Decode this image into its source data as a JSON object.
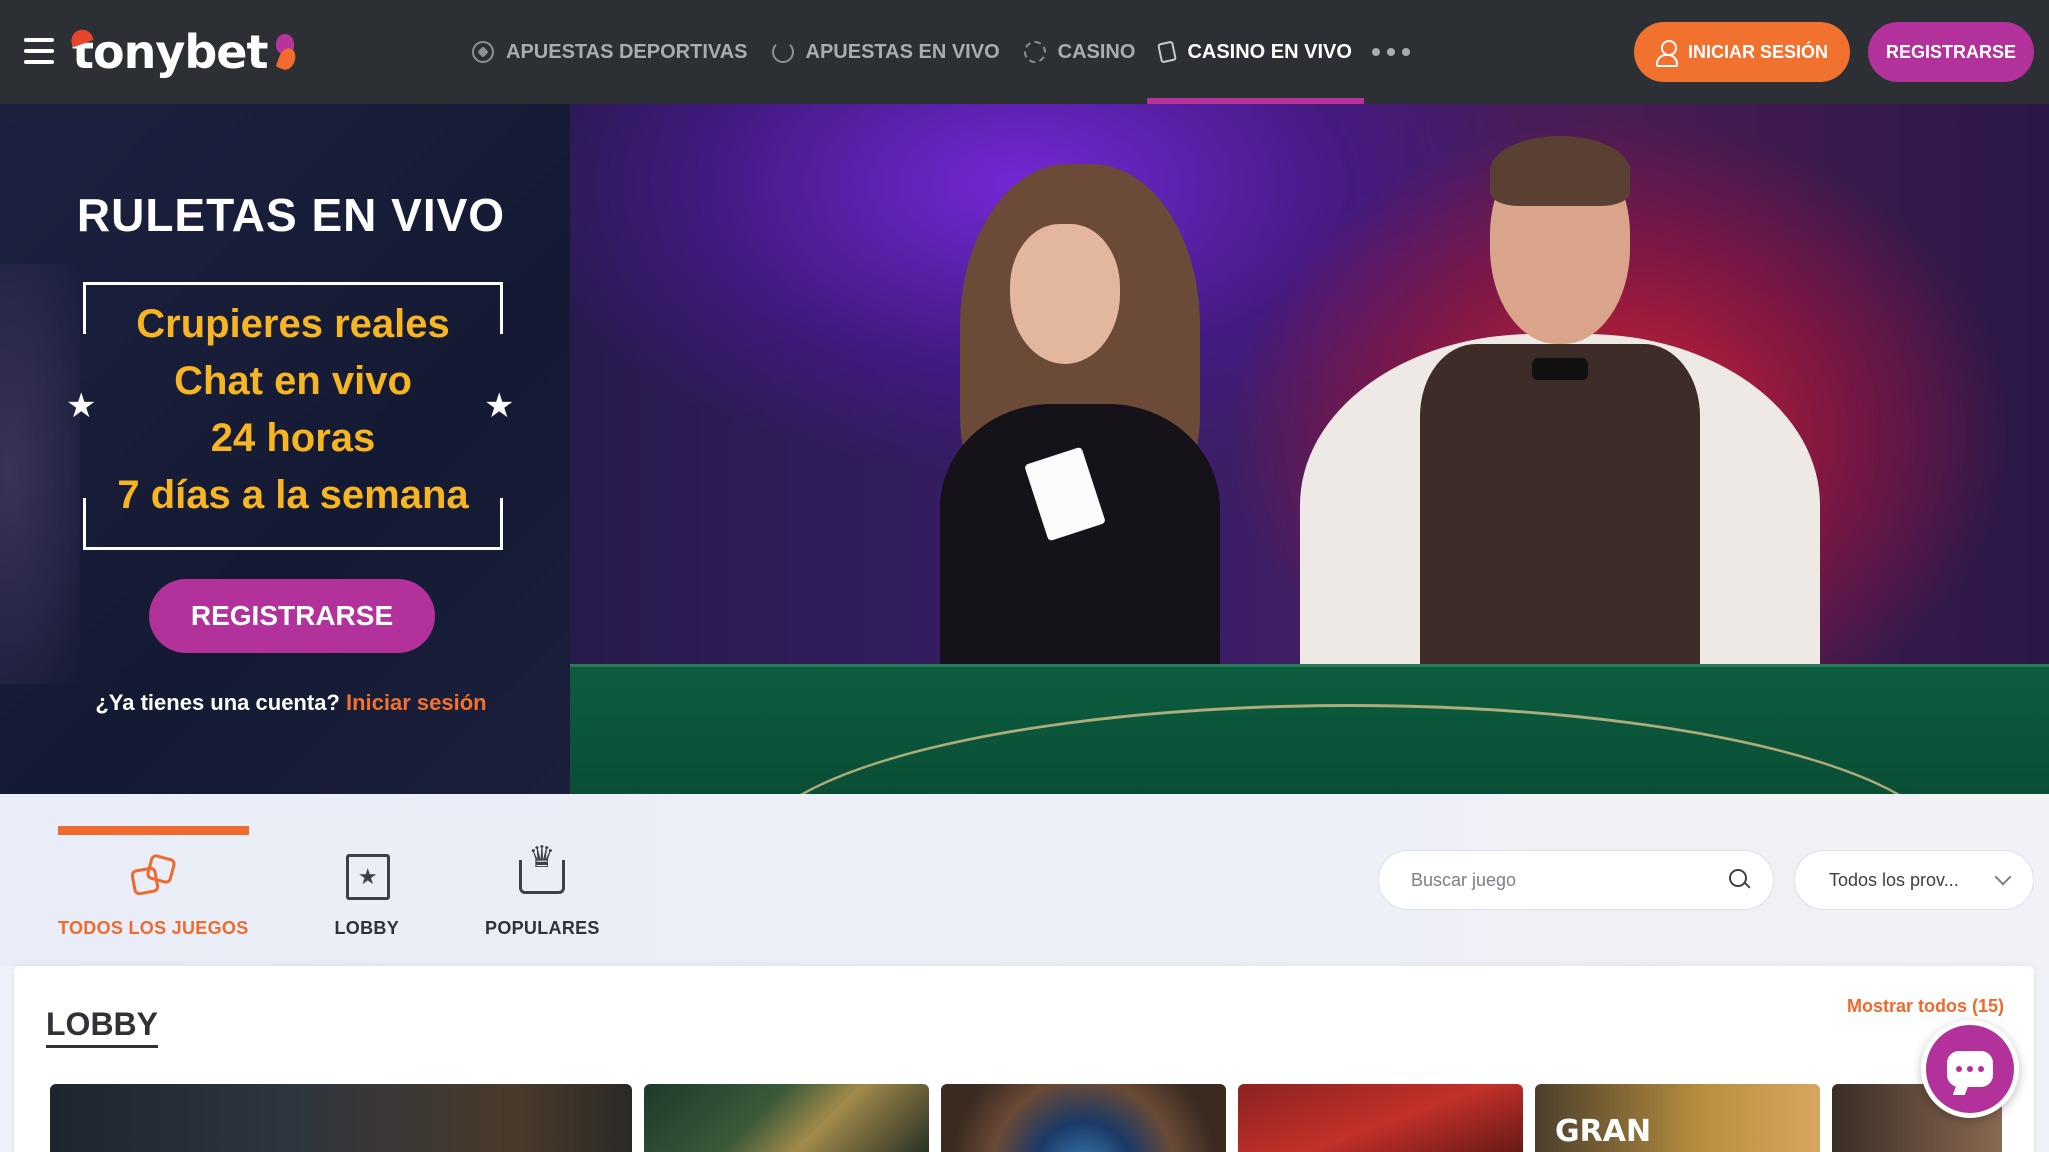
{
  "header": {
    "logo_text": "tonybet",
    "nav": [
      {
        "label": "APUESTAS DEPORTIVAS",
        "icon": "soccer-ball-icon",
        "active": false
      },
      {
        "label": "APUESTAS EN VIVO",
        "icon": "live-ball-icon",
        "active": false
      },
      {
        "label": "CASINO",
        "icon": "casino-chip-icon",
        "active": false
      },
      {
        "label": "CASINO EN VIVO",
        "icon": "cards-icon",
        "active": true
      }
    ],
    "more_icon": "more-dots-icon",
    "login_label": "INICIAR SESIÓN",
    "register_label": "REGISTRARSE"
  },
  "hero": {
    "title": "RULETAS EN VIVO",
    "features": [
      "Crupieres reales",
      "Chat en vivo",
      "24 horas",
      "7 días a la semana"
    ],
    "register_label": "REGISTRARSE",
    "account_question": "¿Ya tienes una cuenta?",
    "login_link": "Iniciar sesión"
  },
  "categories": {
    "tabs": [
      {
        "label": "TODOS LOS JUEGOS",
        "icon": "dice-icon",
        "active": true
      },
      {
        "label": "LOBBY",
        "icon": "film-star-icon",
        "active": false
      },
      {
        "label": "POPULARES",
        "icon": "crown-icon",
        "active": false
      }
    ],
    "search_placeholder": "Buscar juego",
    "provider_selected": "Todos los prov..."
  },
  "lobby": {
    "title": "LOBBY",
    "show_all": "Mostrar todos (15)",
    "tiles": [
      {
        "label": ""
      },
      {
        "label": ""
      },
      {
        "label": ""
      },
      {
        "label": ""
      },
      {
        "label": "GRAN"
      },
      {
        "label": ""
      }
    ]
  },
  "colors": {
    "accent_orange": "#f1712f",
    "brand_purple": "#b2319a",
    "header_bg": "#2c2f33",
    "feature_yellow": "#f7b521"
  }
}
